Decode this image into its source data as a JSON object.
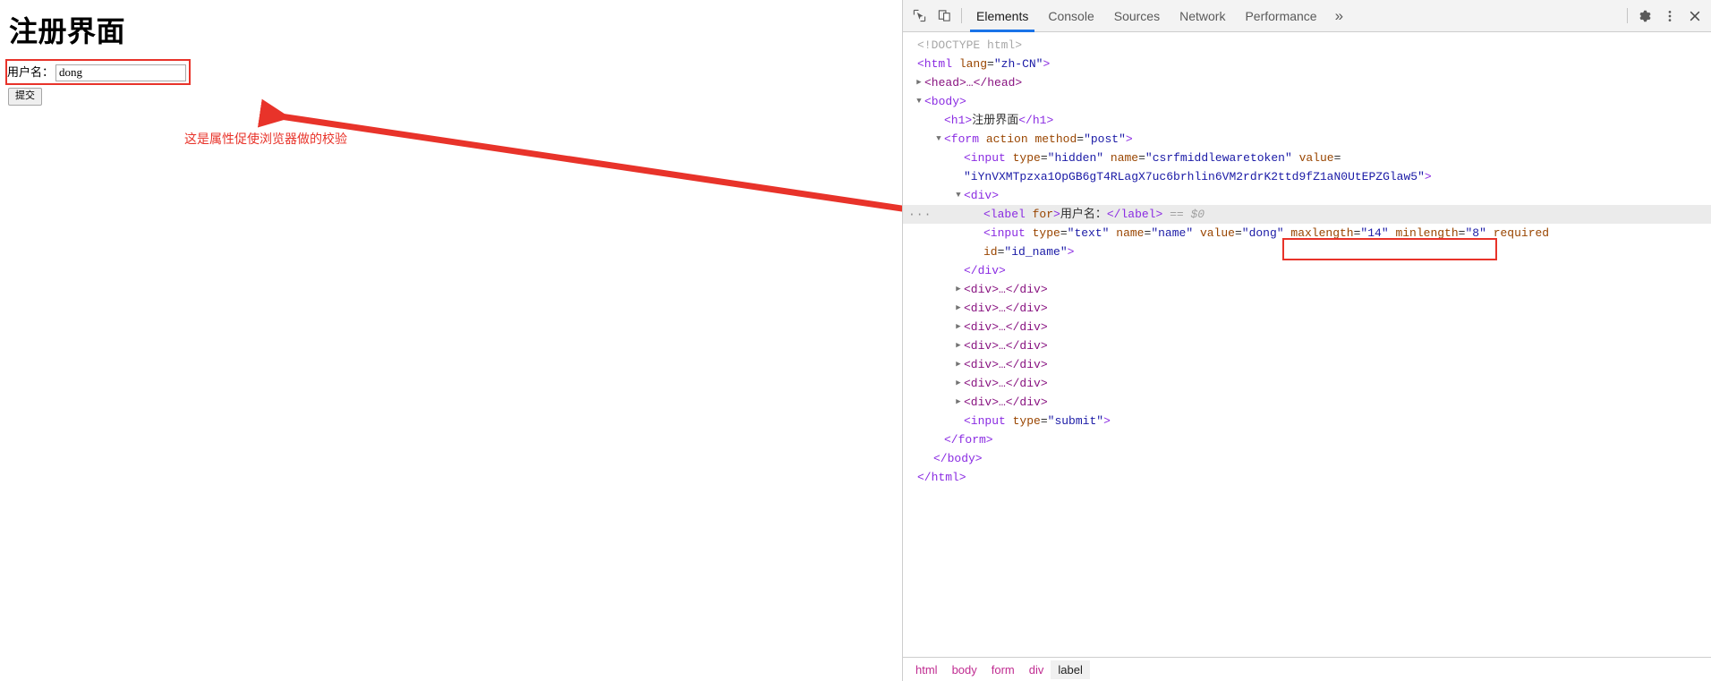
{
  "page": {
    "title": "注册界面",
    "label": "用户名：",
    "input_value": "dong",
    "input_placeholder": "",
    "submit_label": "提交",
    "annotation": "这是属性促使浏览器做的校验"
  },
  "devtools": {
    "icons": {
      "inspect": "inspect-element-icon",
      "device": "device-toolbar-icon",
      "settings": "gear-icon",
      "menu": "kebab-menu-icon",
      "close": "close-icon",
      "more_tabs": "»"
    },
    "tabs": [
      {
        "label": "Elements",
        "active": true
      },
      {
        "label": "Console",
        "active": false
      },
      {
        "label": "Sources",
        "active": false
      },
      {
        "label": "Network",
        "active": false
      },
      {
        "label": "Performance",
        "active": false
      }
    ],
    "dom": {
      "doctype": "<!DOCTYPE html>",
      "html_open_tag": "<html",
      "html_attr_name": "lang",
      "html_attr_value": "\"zh-CN\"",
      "head_row": "<head>…</head>",
      "body_open": "<body>",
      "h1_open": "<h1>",
      "h1_text": "注册界面",
      "h1_close": "</h1>",
      "form_open": "<form",
      "form_attr1": "action",
      "form_attr2": "method",
      "form_attr2_value": "\"post\"",
      "csrf_tag": "<input",
      "csrf_type_name": "type",
      "csrf_type_value": "\"hidden\"",
      "csrf_name_name": "name",
      "csrf_name_value": "\"csrfmiddlewaretoken\"",
      "csrf_value_name": "value",
      "csrf_value_value": "\"iYnVXMTpzxa1OpGB6gT4RLagX7uc6brhlin6VM2rdrK2ttd9fZ1aN0UtEPZGlaw5\"",
      "div_open": "<div>",
      "label_open": "<label",
      "label_attr_for": "for",
      "label_text": "用户名：",
      "label_close": "</label>",
      "selected_marker": "== $0",
      "more_badge": "···",
      "input_tag": "<input",
      "input_type_name": "type",
      "input_type_value": "\"text\"",
      "input_name_name": "name",
      "input_name_value": "\"name\"",
      "input_value_name": "value",
      "input_value_value": "\"dong\"",
      "input_maxlength_name": "maxlength",
      "input_maxlength_value": "\"14\"",
      "input_minlength_name": "minlength",
      "input_minlength_value": "\"8\"",
      "input_required": "required",
      "input_id_name": "id",
      "input_id_value": "\"id_name\"",
      "input_close_bracket": ">",
      "div_close": "</div>",
      "collapsed_div": "<div>…</div>",
      "collapsed_div_count": 7,
      "submit_tag": "<input",
      "submit_type_name": "type",
      "submit_type_value": "\"submit\"",
      "form_close": "</form>",
      "body_close": "</body>",
      "html_close": "</html>"
    },
    "breadcrumb": [
      {
        "label": "html",
        "active": false
      },
      {
        "label": "body",
        "active": false
      },
      {
        "label": "form",
        "active": false
      },
      {
        "label": "div",
        "active": false
      },
      {
        "label": "label",
        "active": true
      }
    ]
  },
  "colors": {
    "accent_blue": "#1a73e8",
    "annotation_red": "#e8332a",
    "tag_purple": "#881280",
    "attr_orange": "#994500",
    "value_blue": "#1a1aa6"
  }
}
